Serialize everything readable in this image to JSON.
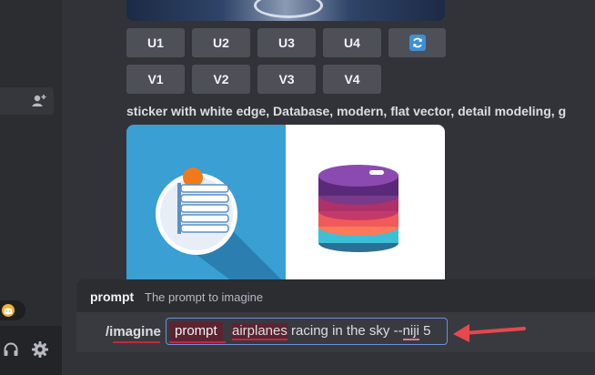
{
  "buttons": {
    "upscale": [
      "U1",
      "U2",
      "U3",
      "U4"
    ],
    "variation": [
      "V1",
      "V2",
      "V3",
      "V4"
    ],
    "refresh_icon": "refresh-icon"
  },
  "message": {
    "caption": "sticker with white edge, Database, modern, flat vector, detail modeling, g"
  },
  "command_popup": {
    "option_name": "prompt",
    "option_description": "The prompt to imagine"
  },
  "input": {
    "command": "/imagine",
    "option_label": "prompt",
    "value_highlight": "airplanes",
    "value_rest": " racing in the sky --",
    "value_flag": "niji",
    "value_end": " 5"
  },
  "colors": {
    "background": "#313338",
    "button": "#4e5058",
    "accent_blue": "#3d8fd6",
    "error_underline": "#c4253f",
    "arrow": "#e5484d"
  },
  "icons": [
    "add-member-icon",
    "discord-icon",
    "headphones-icon",
    "settings-icon",
    "refresh-icon"
  ]
}
